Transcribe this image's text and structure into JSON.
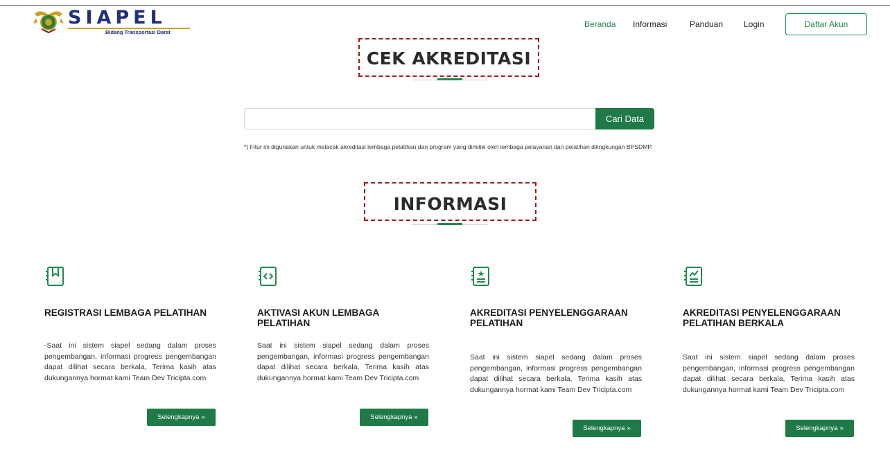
{
  "header": {
    "logo_text": "SIAPEL",
    "logo_subtitle": "Bidang Transportasi Darat",
    "nav": [
      "Beranda",
      "Informasi",
      "Panduan",
      "Login"
    ],
    "register_button": "Daftar Akun"
  },
  "cek": {
    "title": "CEK AKREDITASI",
    "search_value": "",
    "search_button": "Cari Data",
    "note": "*) Fitur ini digunakan untuk melacak akreditasi lembaga pelatihan dan program yang dimiliki oleh lembaga pelayanan dan pelatihan dilingkungan BPSDMP."
  },
  "informasi": {
    "title": "INFORMASI",
    "more_label": "Selengkapnya",
    "cards": [
      {
        "icon": "book-icon",
        "title": "REGISTRASI LEMBAGA PELATIHAN",
        "desc": "-Saat ini sistem siapel sedang dalam proses pengembangan, informasi progress pengembangan dapat dilihat secara berkala, Terima kasih atas dukungannya hormat kami Team Dev Tricipta.com"
      },
      {
        "icon": "code-icon",
        "title": "AKTIVASI AKUN LEMBAGA PELATIHAN",
        "desc": "Saat ini sistem siapel sedang dalam proses pengembangan, informasi progress pengembangan dapat dilihat secara berkala, Terima kasih atas dukungannya hormat kami Team Dev Tricipta.com"
      },
      {
        "icon": "star-list-icon",
        "title": "AKREDITASI PENYELENGGARAAN PELATIHAN",
        "desc": "Saat ini sistem siapel sedang dalam proses pengembangan, informasi progress pengembangan dapat dilihat secara berkala, Terima kasih atas dukungannya hormat kami Team Dev Tricipta.com"
      },
      {
        "icon": "chart-list-icon",
        "title": "AKREDITASI PENYELENGGARAAN PELATIHAN BERKALA",
        "desc": "Saat ini sistem siapel sedang dalam proses pengembangan, informasi progress pengembangan dapat dilihat secara berkala, Terima kasih atas dukungannya hormat kami Team Dev Tricipta.com"
      }
    ]
  },
  "colors": {
    "brand_green": "#1f7a47",
    "nav_active": "#1f8a4d",
    "logo_blue": "#20307a",
    "annotation_red": "#a01a1a"
  }
}
